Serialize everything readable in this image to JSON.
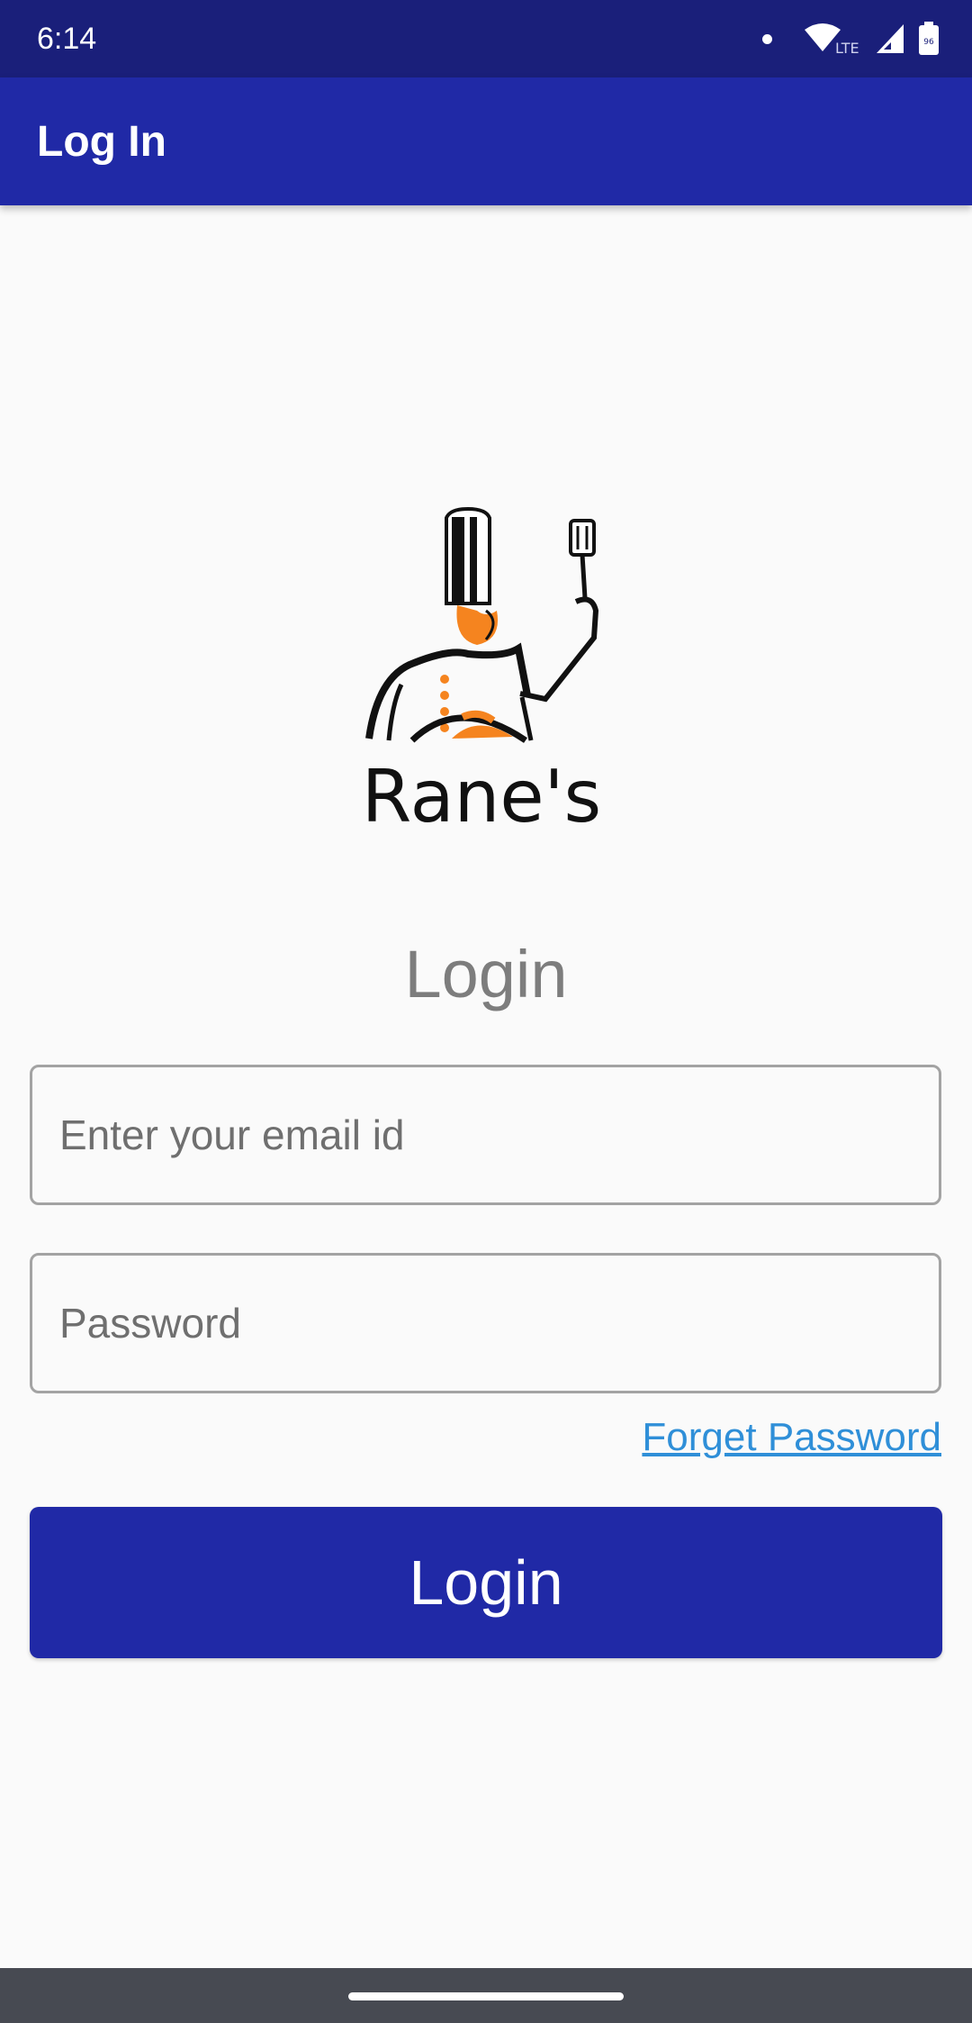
{
  "status_bar": {
    "time": "6:14",
    "network_label": "LTE",
    "battery_level": "96",
    "icons": [
      "notification-dot",
      "wifi-icon",
      "signal-icon",
      "battery-icon"
    ]
  },
  "app_bar": {
    "title": "Log In",
    "background_color": "#2029a6"
  },
  "logo": {
    "brand_name": "Rane's",
    "icon": "chef-icon",
    "accent_color": "#f5841f"
  },
  "form": {
    "heading": "Login",
    "email_placeholder": "Enter your email id",
    "email_value": "",
    "password_placeholder": "Password",
    "password_value": "",
    "forget_password_label": "Forget Password",
    "login_button_label": "Login",
    "link_color": "#2f8fd8"
  }
}
